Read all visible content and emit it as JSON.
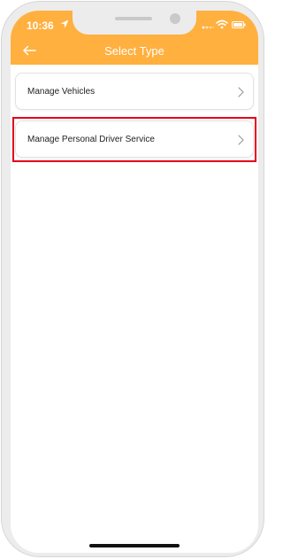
{
  "status_bar": {
    "time": "10:36"
  },
  "header": {
    "title": "Select Type",
    "back_icon": "arrow-left-icon"
  },
  "list": {
    "items": [
      {
        "label": "Manage Vehicles"
      },
      {
        "label": "Manage Personal Driver Service"
      }
    ]
  },
  "colors": {
    "header_bg": "#ffb03f",
    "highlight": "#e3001b"
  }
}
